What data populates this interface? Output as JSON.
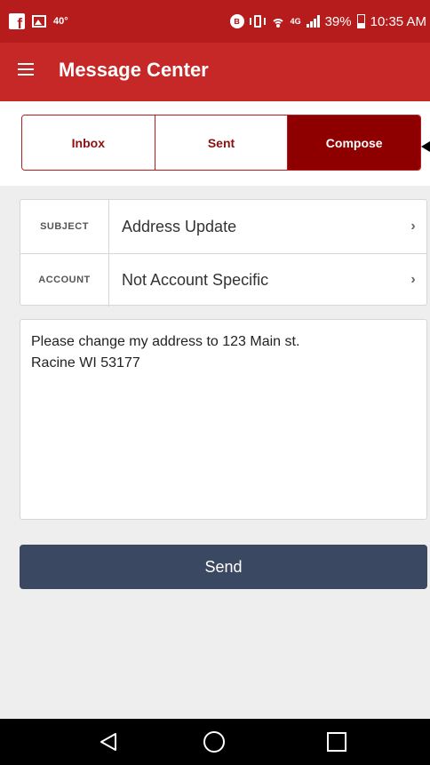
{
  "status_bar": {
    "temperature": "40°",
    "network": "4G",
    "battery_percent": "39%",
    "battery_level": 0.39,
    "time": "10:35 AM",
    "icons": [
      "facebook-icon",
      "gallery-icon",
      "bluetooth-icon",
      "vibrate-icon",
      "wifi-icon",
      "signal-icon",
      "battery-icon"
    ]
  },
  "app_bar": {
    "title": "Message Center",
    "menu_icon": "hamburger-menu-icon"
  },
  "tabs": [
    {
      "label": "Inbox",
      "active": false
    },
    {
      "label": "Sent",
      "active": false
    },
    {
      "label": "Compose",
      "active": true
    }
  ],
  "form": {
    "subject": {
      "label": "SUBJECT",
      "value": "Address Update"
    },
    "account": {
      "label": "ACCOUNT",
      "value": "Not Account Specific"
    },
    "message": "Please change my address to 123 Main st.\nRacine WI 53177"
  },
  "send_button": {
    "label": "Send"
  },
  "colors": {
    "status_bar": "#b71c1c",
    "app_bar": "#c62828",
    "active_tab": "#8e0000",
    "send_button": "#3b4861",
    "background": "#eeeeee"
  },
  "nav_bar": {
    "icons": [
      "back-icon",
      "home-icon",
      "recent-apps-icon"
    ]
  }
}
